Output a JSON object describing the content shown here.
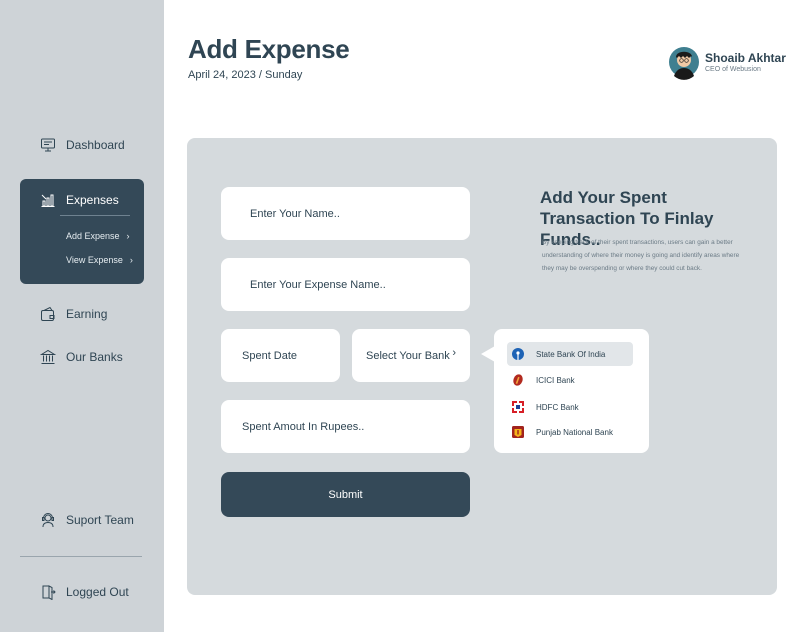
{
  "header": {
    "title": "Add Expense",
    "date": "April 24, 2023 / Sunday"
  },
  "profile": {
    "name": "Shoaib Akhtar",
    "role": "CEO of Webusion"
  },
  "sidebar": {
    "items": [
      {
        "label": "Dashboard",
        "icon": "dashboard-icon"
      },
      {
        "label": "Expenses",
        "icon": "expenses-icon",
        "active": true,
        "sub_items": [
          {
            "label": "Add Expense"
          },
          {
            "label": "View Expense"
          }
        ]
      },
      {
        "label": "Earning",
        "icon": "wallet-icon"
      },
      {
        "label": "Our Banks",
        "icon": "bank-icon"
      },
      {
        "label": "Suport Team",
        "icon": "support-icon"
      },
      {
        "label": "Logged Out",
        "icon": "logout-icon"
      }
    ]
  },
  "form": {
    "name_placeholder": "Enter Your Name..",
    "expense_placeholder": "Enter Your Expense Name..",
    "date_placeholder": "Spent Date",
    "bank_placeholder": "Select Your Bank",
    "amount_placeholder": "Spent Amout In Rupees..",
    "submit_label": "Submit"
  },
  "info": {
    "title": "Add Your Spent Transaction To Finlay Funds..",
    "body": "By keeping track of their spent transactions, users can gain a better understanding of where their money is going and identify areas where they may be overspending or where they could cut back."
  },
  "bank_dropdown": {
    "options": [
      {
        "label": "State Bank Of India",
        "icon": "sbi-icon",
        "selected": true
      },
      {
        "label": "ICICI Bank",
        "icon": "icici-icon",
        "selected": false
      },
      {
        "label": "HDFC Bank",
        "icon": "hdfc-icon",
        "selected": false
      },
      {
        "label": "Punjab National Bank",
        "icon": "pnb-icon",
        "selected": false
      }
    ]
  },
  "colors": {
    "primary": "#344958",
    "sidebar_bg": "#ced3d7",
    "panel_bg": "#d5dadd",
    "text": "#2f4553"
  }
}
